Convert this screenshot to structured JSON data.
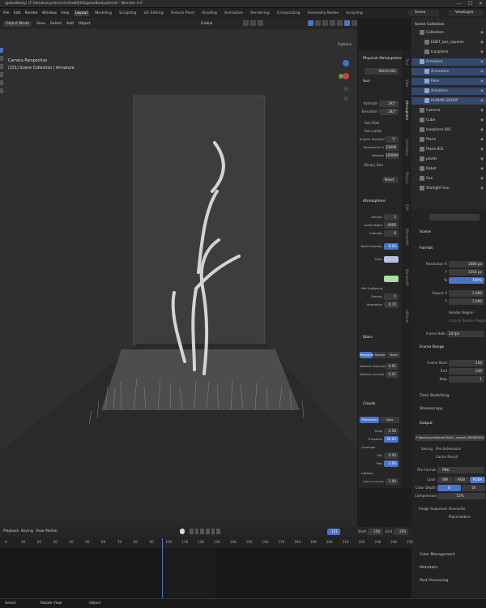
{
  "window": {
    "title": "(gotodbody) (F:\\dendrocycles\\scen\\GobS\\04\\gotodbody.blend) - Blender 4.0",
    "controls": [
      "—",
      "☐",
      "✕"
    ]
  },
  "menu": {
    "items": [
      "File",
      "Edit",
      "Render",
      "Window",
      "Help"
    ],
    "workspaces": [
      "Layout",
      "Modeling",
      "Sculpting",
      "UV Editing",
      "Texture Paint",
      "Shading",
      "Animation",
      "Rendering",
      "Compositing",
      "Geometry Nodes",
      "Scripting"
    ],
    "active_workspace": "Layout",
    "scene": "Scene",
    "view_layer": "ViewLayer"
  },
  "viewport": {
    "mode": "Object Mode",
    "menus": [
      "View",
      "Select",
      "Add",
      "Object"
    ],
    "transform": "Global",
    "options": "Options",
    "info_line1": "Camera Perspective",
    "info_line2": "(151) Scene Collection | Armature"
  },
  "atmosphere_panel": {
    "header": "Physical Atmosphere",
    "world": "World.001",
    "sun_label": "Sun",
    "azimuth_label": "Azimuth",
    "azimuth": "191°",
    "elevation_label": "Elevation",
    "elevation": "182°",
    "sun_disk": "Sun Disk",
    "sun_lamp": "Sun Lamp",
    "angular_diameter_label": "Angular Diameter",
    "angular_diameter": "1°",
    "temperature_label": "Temperature K",
    "temperature": "23000",
    "intensity_label": "Intensity",
    "intensity": "100000",
    "binary_sun": "Binary Sun",
    "reset": "Reset",
    "atmosphere_header": "Atmosphere",
    "density_label": "Density",
    "density": "1",
    "scale_height_label": "Scale Height",
    "scale_height": "4000 m",
    "atm_intensity_label": "Intensity",
    "atm_intensity": "6",
    "night_intensity_label": "Night Intensity",
    "night_intensity": "0.04",
    "color_label": "Color",
    "scattering_label": "Mie Scattering",
    "mie_density_label": "Density",
    "mie_density": "1",
    "mie_absorption_label": "Absorption",
    "mie_absorption": "0.70",
    "stars_header": "Stars",
    "stars_tabs": [
      "Procedural",
      "Texture",
      "Moon"
    ],
    "radiance_label": "Radiance (Intensity)",
    "radiance": "0.01",
    "radiance2_label": "Radiance (Ground)",
    "radiance2": "0.01",
    "clouds_header": "Clouds",
    "clouds_tabs": [
      "Procedural",
      "Atlas"
    ],
    "scale_label": "Scale",
    "scale": "2.50",
    "thickness_label": "Thickness",
    "thickness": "30.00",
    "coverage_label": "Coverage",
    "min_label": "Min",
    "min": "0.00",
    "max_label": "Max",
    "max": "1.00",
    "lighting_label": "Lighting",
    "lighting_intensity_label": "Lighting Intensity",
    "lighting_intensity": "1.00",
    "self_shadowing_label": "Self Shadowing",
    "self_shadowing": "5.00",
    "directional_label": "Directional Power",
    "directional": "5.00",
    "side_tabs": [
      "Tool",
      "View",
      "Atmosphere",
      "Animation",
      "Physics",
      "Edit",
      "BlenderKit",
      "BlenderKit",
      "ARPanel"
    ]
  },
  "outliner": {
    "header": "Scene Collection",
    "items": [
      {
        "name": "Collection",
        "depth": 1,
        "sel": false
      },
      {
        "name": "EGBT_bar_squares",
        "depth": 2,
        "sel": false
      },
      {
        "name": "Icosphere",
        "depth": 2,
        "sel": false
      },
      {
        "name": "Armature",
        "depth": 1,
        "sel": true
      },
      {
        "name": "Animation",
        "depth": 2,
        "sel": true
      },
      {
        "name": "Pose",
        "depth": 2,
        "sel": true
      },
      {
        "name": "Armature",
        "depth": 2,
        "sel": true
      },
      {
        "name": "HUMAN GROUP",
        "depth": 2,
        "sel": true
      },
      {
        "name": "Camera",
        "depth": 1,
        "sel": false
      },
      {
        "name": "Cube",
        "depth": 1,
        "sel": false
      },
      {
        "name": "Icosphere.001",
        "depth": 1,
        "sel": false
      },
      {
        "name": "Plane",
        "depth": 1,
        "sel": false
      },
      {
        "name": "Plane.001",
        "depth": 1,
        "sel": false
      },
      {
        "name": "plants",
        "depth": 1,
        "sel": false
      },
      {
        "name": "Robot",
        "depth": 1,
        "sel": false
      },
      {
        "name": "Sun",
        "depth": 1,
        "sel": false
      },
      {
        "name": "Starlight Sun",
        "depth": 1,
        "sel": false
      }
    ]
  },
  "properties": {
    "scene_name": "Scene",
    "format_header": "Format",
    "res_x_label": "Resolution X",
    "res_x": "1080 px",
    "res_y_label": "Y",
    "res_y": "1350 px",
    "res_pct_label": "%",
    "res_pct": "100%",
    "aspect_x_label": "Aspect X",
    "aspect_x": "1.000",
    "aspect_y_label": "Y",
    "aspect_y": "1.000",
    "render_region": "Render Region",
    "crop_region": "Crop to Render Region",
    "frame_rate_label": "Frame Rate",
    "frame_rate": "24 fps",
    "frame_range_header": "Frame Range",
    "frame_start_label": "Frame Start",
    "frame_start": "150",
    "end_label": "End",
    "end": "250",
    "step_label": "Step",
    "step": "1",
    "time_stretching": "Time Stretching",
    "stereoscopy": "Stereoscopy",
    "output_header": "Output",
    "output_path": "F:\\dendrocycles\\scen\\GobS...\\scene4_RENDERS\\SCENE 2",
    "saving_label": "Saving",
    "file_extensions": "File Extensions",
    "cache_result": "Cache Result",
    "file_format_label": "File Format",
    "file_format": "PNG",
    "color_label": "Color",
    "color_options": [
      "BW",
      "RGB",
      "RGBA"
    ],
    "color_active": "RGBA",
    "color_depth_label": "Color Depth",
    "color_depth_options": [
      "8",
      "16"
    ],
    "compression_label": "Compression",
    "compression": "15%",
    "image_sequence_label": "Image Sequence",
    "overwrite": "Overwrite",
    "placeholders": "Placeholders",
    "color_management": "Color Management",
    "metadata": "Metadata",
    "post_processing": "Post Processing"
  },
  "timeline": {
    "menus": [
      "Playback",
      "Keying",
      "View",
      "Marker"
    ],
    "current_frame": "151",
    "start_label": "Start",
    "start": "150",
    "end_label": "End",
    "end": "250",
    "ticks": [
      "0",
      "10",
      "20",
      "30",
      "40",
      "50",
      "60",
      "70",
      "80",
      "90",
      "100",
      "110",
      "120",
      "130",
      "140",
      "150",
      "160",
      "170",
      "180",
      "190",
      "200",
      "210",
      "220",
      "230",
      "240",
      "250"
    ]
  },
  "status": {
    "left": "Select",
    "middle": "Rotate View",
    "right": "Object"
  }
}
